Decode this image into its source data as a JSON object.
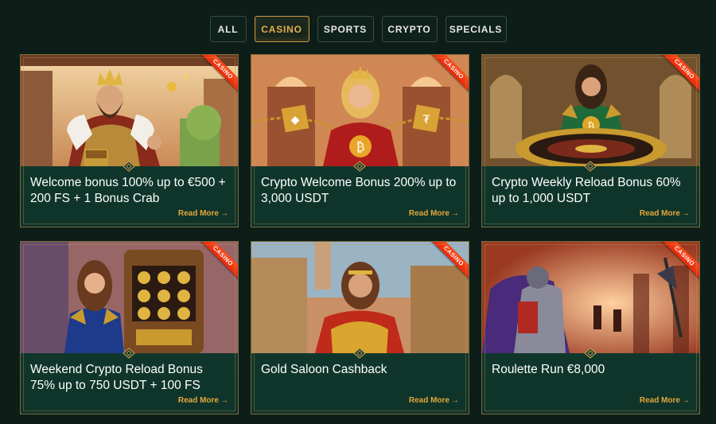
{
  "filters": {
    "all": "ALL",
    "casino": "CASINO",
    "sports": "SPORTS",
    "crypto": "CRYPTO",
    "specials": "SPECIALS",
    "active": "casino"
  },
  "read_more_label": "Read More",
  "ribbon_label": "CASINO",
  "colors": {
    "background": "#0d1d18",
    "card": "#113e32",
    "accent": "#e4a73c",
    "ribbon": "#ff4a1a"
  },
  "promos": [
    {
      "title": "Welcome bonus 100% up to €500 + 200 FS + 1 Bonus Crab",
      "ribbon": "CASINO",
      "cta": "Read More"
    },
    {
      "title": "Crypto Welcome Bonus 200% up to 3,000 USDT",
      "ribbon": "CASINO",
      "cta": "Read More"
    },
    {
      "title": "Crypto Weekly Reload Bonus 60% up to 1,000 USDT",
      "ribbon": "CASINO",
      "cta": "Read More"
    },
    {
      "title": "Weekend Crypto Reload Bonus 75% up to 750 USDT + 100 FS",
      "ribbon": "CASINO",
      "cta": "Read More"
    },
    {
      "title": "Gold Saloon Cashback",
      "ribbon": "CASINO",
      "cta": "Read More"
    },
    {
      "title": "Roulette Run €8,000",
      "ribbon": "CASINO",
      "cta": "Read More"
    }
  ]
}
